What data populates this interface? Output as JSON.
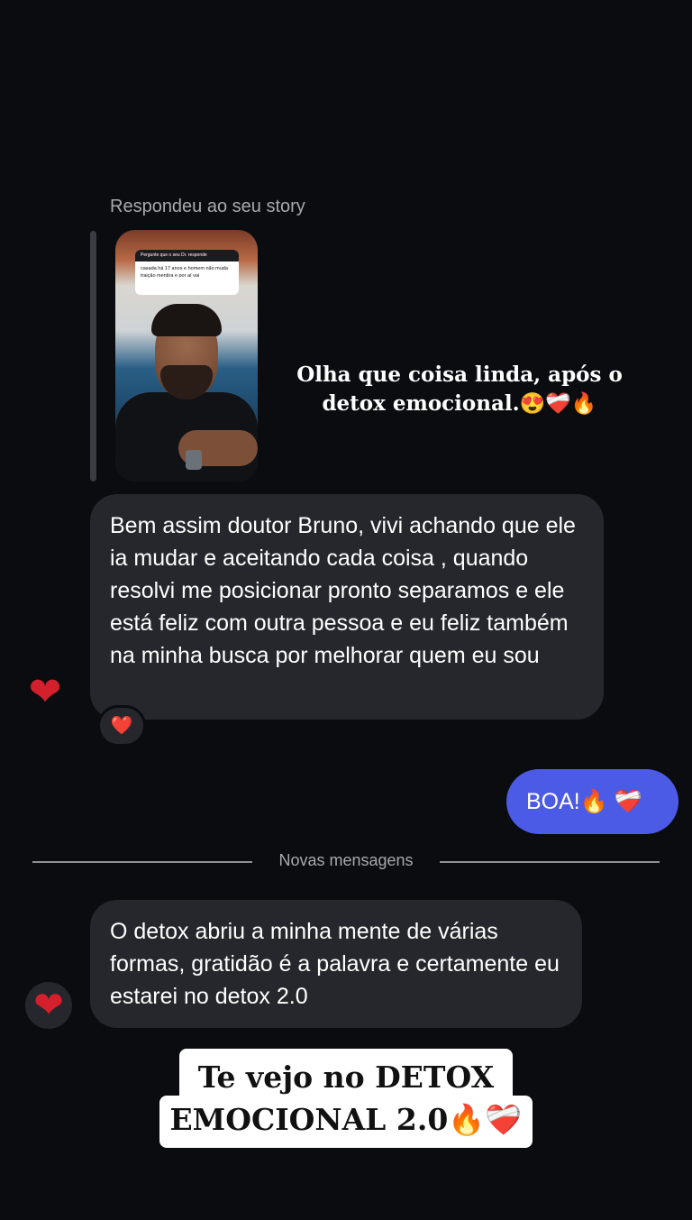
{
  "story_reply": {
    "label": "Respondeu ao seu story",
    "thumbnail": {
      "question_header": "Pergunte que o seu Dr. responde",
      "question_text": "casada há 17 anos e homem não muda traição mentira e por aí vai"
    }
  },
  "overlay_top": {
    "text": "Olha que coisa linda, após o detox emocional.😍❤️‍🩹🔥"
  },
  "messages": [
    {
      "direction": "incoming",
      "text": "Bem assim doutor Bruno,  vivi achando que ele ia mudar e aceitando cada coisa , quando resolvi me posicionar pronto separamos e ele está feliz com outra pessoa e eu feliz também na minha busca por melhorar quem eu sou",
      "reaction": "❤️"
    },
    {
      "direction": "outgoing",
      "text": "BOA!🔥 ❤️‍🩹"
    },
    {
      "direction": "incoming",
      "text": "O detox abriu a minha mente de várias formas, gratidão é a palavra e certamente eu estarei no detox 2.0"
    }
  ],
  "divider": {
    "label": "Novas mensagens"
  },
  "avatar_icon": "mending-heart",
  "overlay_bottom": {
    "line1": "Te vejo no DETOX",
    "line2": "EMOCIONAL 2.0🔥❤️‍🩹"
  },
  "colors": {
    "background": "#0b0c10",
    "incoming_bubble": "#26272c",
    "outgoing_bubble": "#4c5be6",
    "secondary_text": "#a7a9ae"
  }
}
